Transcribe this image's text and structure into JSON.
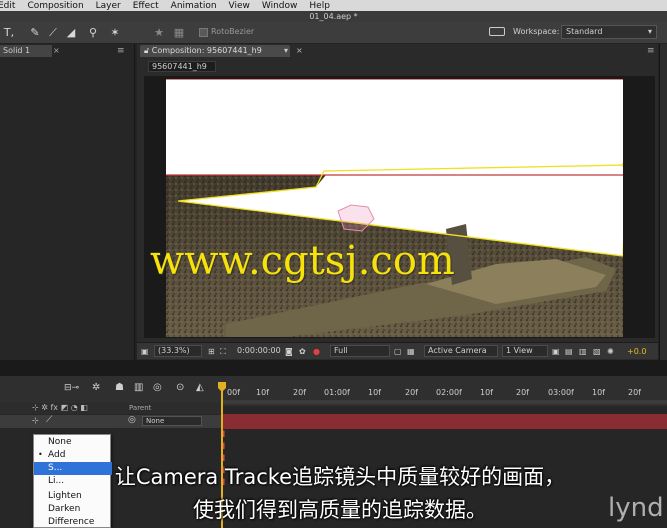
{
  "menu": [
    "Edit",
    "Composition",
    "Layer",
    "Effect",
    "Animation",
    "View",
    "Window",
    "Help"
  ],
  "file_title": "01_04.aep *",
  "toolbar": {
    "rotobezier_label": "RotoBezier",
    "workspace_label": "Workspace:",
    "workspace_value": "Standard"
  },
  "left_panel": {
    "tab_label": "Solid 1",
    "tab_suffix": "▾"
  },
  "comp": {
    "tab_label": "Composition: 95607441_h9",
    "subtab_label": "95607441_h9"
  },
  "viewer": {
    "watermark": "www.cgtsj.com"
  },
  "comp_footer": {
    "zoom": "(33.3%)",
    "timecode": "0:00:00:00",
    "resolution": "Full",
    "camera": "Active Camera",
    "view": "1 View",
    "exposure": "+0.0"
  },
  "timeline": {
    "ticks": [
      "00f",
      "10f",
      "20f",
      "01:00f",
      "10f",
      "20f",
      "02:00f",
      "10f",
      "20f",
      "03:00f",
      "10f",
      "20f"
    ],
    "parent_label": "Parent",
    "parent_value": "None",
    "keyframe_glyph": "I"
  },
  "blend_menu": {
    "items": [
      "None",
      "Add",
      "Screen",
      "Lighten",
      "Darken",
      "Difference"
    ],
    "visible_items": [
      "None",
      "Add",
      "S...",
      "Li...",
      "Lighten",
      "Darken",
      "Difference"
    ],
    "selected": "Screen"
  },
  "subtitles": {
    "line1": "让Camera Tracke追踪镜头中质量较好的画面，",
    "line2": "使我们得到高质量的追踪数据。"
  },
  "logo": "lynd",
  "colors": {
    "accent": "#e1b021",
    "mask": "#c03a3a",
    "track": "#f0e020",
    "selection": "#2f73d8"
  }
}
